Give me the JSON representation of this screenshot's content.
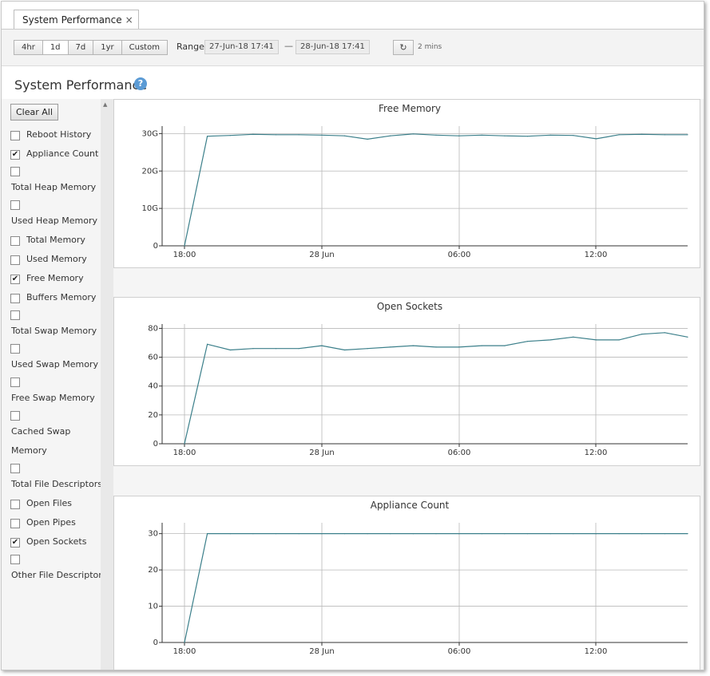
{
  "tab": {
    "title": "System Performance",
    "close": "×"
  },
  "toolbar": {
    "range_buttons": [
      "4hr",
      "1d",
      "7d",
      "1yr",
      "Custom"
    ],
    "range_label": "Range",
    "start": "27-Jun-18 17:41",
    "separator": "—",
    "end": "28-Jun-18 17:41",
    "refresh_icon": "↻",
    "refresh_interval": "2 mins"
  },
  "page": {
    "title": "System Performance",
    "help_glyph": "?"
  },
  "sidebar": {
    "clear_all": "Clear All",
    "items": [
      {
        "label": "Reboot History",
        "checked": false
      },
      {
        "label": "Appliance Count",
        "checked": true
      },
      {
        "label": "Total Heap Memory",
        "checked": false
      },
      {
        "label": "Used Heap Memory",
        "checked": false
      },
      {
        "label": "Total Memory",
        "checked": false
      },
      {
        "label": "Used Memory",
        "checked": false
      },
      {
        "label": "Free Memory",
        "checked": true
      },
      {
        "label": "Buffers Memory",
        "checked": false
      },
      {
        "label": "Total Swap Memory",
        "checked": false
      },
      {
        "label": "Used Swap Memory",
        "checked": false
      },
      {
        "label": "Free Swap Memory",
        "checked": false
      },
      {
        "label": "Cached Swap Memory",
        "label_line1": "Cached Swap",
        "label_line2": "Memory",
        "checked": false
      },
      {
        "label": "Total File Descriptors",
        "checked": false
      },
      {
        "label": "Open Files",
        "checked": false
      },
      {
        "label": "Open Pipes",
        "checked": false
      },
      {
        "label": "Open Sockets",
        "checked": true
      },
      {
        "label": "Other File Descriptors",
        "checked": false
      }
    ]
  },
  "colors": {
    "line": "#3b7f8a",
    "grid": "#b8b8b8",
    "axis": "#333333"
  },
  "chart_data": [
    {
      "type": "line",
      "title": "Free Memory",
      "xticks": [
        "18:00",
        "28 Jun",
        "06:00",
        "12:00"
      ],
      "yticks": [
        "0",
        "10G",
        "20G",
        "30G"
      ],
      "ylim": [
        0,
        32
      ],
      "xlabel": "",
      "ylabel": "",
      "x": [
        0,
        1,
        2,
        3,
        4,
        5,
        6,
        7,
        8,
        9,
        10,
        11,
        12,
        13,
        14,
        15,
        16,
        17,
        18,
        19,
        20,
        21,
        22
      ],
      "series": [
        {
          "values": [
            0,
            29.3,
            29.5,
            29.8,
            29.7,
            29.7,
            29.6,
            29.4,
            28.5,
            29.4,
            29.9,
            29.6,
            29.4,
            29.6,
            29.4,
            29.3,
            29.6,
            29.5,
            28.6,
            29.7,
            29.8,
            29.7,
            29.7
          ]
        }
      ],
      "grid": true
    },
    {
      "type": "line",
      "title": "Open Sockets",
      "xticks": [
        "18:00",
        "28 Jun",
        "06:00",
        "12:00"
      ],
      "yticks": [
        "0",
        "20",
        "40",
        "60",
        "80"
      ],
      "ylim": [
        0,
        83
      ],
      "xlabel": "",
      "ylabel": "",
      "x": [
        0,
        1,
        2,
        3,
        4,
        5,
        6,
        7,
        8,
        9,
        10,
        11,
        12,
        13,
        14,
        15,
        16,
        17,
        18,
        19,
        20,
        21,
        22
      ],
      "series": [
        {
          "values": [
            0,
            69,
            65,
            66,
            66,
            66,
            68,
            65,
            66,
            67,
            68,
            67,
            67,
            68,
            68,
            71,
            72,
            74,
            72,
            72,
            76,
            77,
            74
          ]
        }
      ],
      "grid": true
    },
    {
      "type": "line",
      "title": "Appliance Count",
      "xticks": [
        "18:00",
        "28 Jun",
        "06:00",
        "12:00"
      ],
      "yticks": [
        "0",
        "10",
        "20",
        "30"
      ],
      "ylim": [
        0,
        33
      ],
      "xlabel": "",
      "ylabel": "",
      "x": [
        0,
        1,
        2,
        3,
        4,
        5,
        6,
        7,
        8,
        9,
        10,
        11,
        12,
        13,
        14,
        15,
        16,
        17,
        18,
        19,
        20,
        21,
        22
      ],
      "series": [
        {
          "values": [
            0,
            30,
            30,
            30,
            30,
            30,
            30,
            30,
            30,
            30,
            30,
            30,
            30,
            30,
            30,
            30,
            30,
            30,
            30,
            30,
            30,
            30,
            30
          ]
        }
      ],
      "grid": true
    }
  ]
}
